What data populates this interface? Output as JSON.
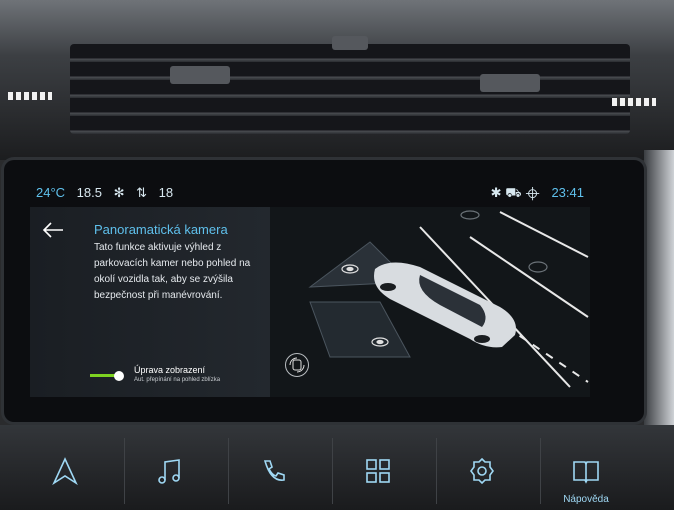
{
  "status": {
    "outside_temp": "24°C",
    "cabin_temp": "18.5",
    "fan_level": "18",
    "clock": "23:41",
    "icons": [
      "fan-icon",
      "seat-airflow-icon",
      "bluetooth-icon",
      "car-icon",
      "location-icon"
    ]
  },
  "panel": {
    "title": "Panoramatická kamera",
    "description": "Tato funkce aktivuje výhled z parkovacích kamer nebo pohled na okolí vozidla tak, aby se zvýšila bezpečnost při manévrování.",
    "toggle_label": "Úprava zobrazení",
    "toggle_sublabel": "Aut. přepínání na pohled zblízka",
    "toggle_on": true
  },
  "camera": {
    "view": "360-degree top-down vehicle view",
    "button_icon": "camera-switch-icon"
  },
  "nav": [
    {
      "icon": "navigation-icon",
      "label": ""
    },
    {
      "icon": "music-icon",
      "label": ""
    },
    {
      "icon": "phone-icon",
      "label": ""
    },
    {
      "icon": "apps-grid-icon",
      "label": ""
    },
    {
      "icon": "settings-icon",
      "label": ""
    },
    {
      "icon": "manual-book-icon",
      "label": "Nápověda"
    }
  ],
  "colors": {
    "accent": "#5fc0ec",
    "toggle_on": "#7ed321",
    "screen_bg": "#0f1318"
  }
}
